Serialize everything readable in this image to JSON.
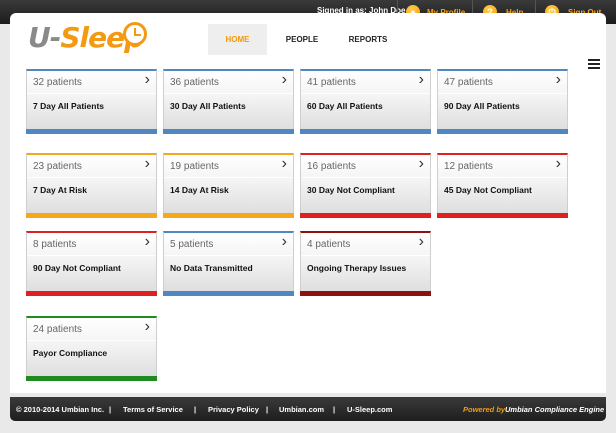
{
  "app": {
    "logo_prefix": "U-",
    "logo_suffix": "Sleep"
  },
  "topbar": {
    "signed_in": "Signed in as: John Doe",
    "my_profile": "My Profile",
    "help": "Help",
    "sign_out": "Sign Out"
  },
  "nav": {
    "home": "HOME",
    "people": "PEOPLE",
    "reports": "REPORTS"
  },
  "colors": {
    "blue": "#4f87c0",
    "orange": "#f5a81c",
    "red": "#e02020",
    "dark_red": "#8f1010",
    "green": "#1f8a1f"
  },
  "cards": [
    {
      "count": "32 patients",
      "title": "7 Day All Patients",
      "color": "blue"
    },
    {
      "count": "36 patients",
      "title": "30 Day All Patients",
      "color": "blue"
    },
    {
      "count": "41 patients",
      "title": "60 Day All Patients",
      "color": "blue"
    },
    {
      "count": "47 patients",
      "title": "90 Day All Patients",
      "color": "blue"
    },
    {
      "count": "23 patients",
      "title": "7 Day At Risk",
      "color": "orange"
    },
    {
      "count": "19 patients",
      "title": "14 Day At Risk",
      "color": "orange"
    },
    {
      "count": "16 patients",
      "title": "30 Day Not Compliant",
      "color": "red"
    },
    {
      "count": "12 patients",
      "title": "45 Day Not Compliant",
      "color": "red"
    },
    {
      "count": "8 patients",
      "title": "90 Day Not Compliant",
      "color": "red"
    },
    {
      "count": "5 patients",
      "title": "No Data Transmitted",
      "color": "blue"
    },
    {
      "count": "4 patients",
      "title": "Ongoing Therapy Issues",
      "color": "dark_red"
    },
    {
      "count": "24 patients",
      "title": "Payor Compliance",
      "color": "green"
    }
  ],
  "footer": {
    "copyright": "© 2010-2014 Umbian Inc.",
    "sep": "|",
    "terms": "Terms of Service",
    "privacy": "Privacy Policy",
    "umbian": "Umbian.com",
    "usleep": "U-Sleep.com",
    "powered_by": "Powered by",
    "engine": "Umbian Compliance Engine"
  }
}
